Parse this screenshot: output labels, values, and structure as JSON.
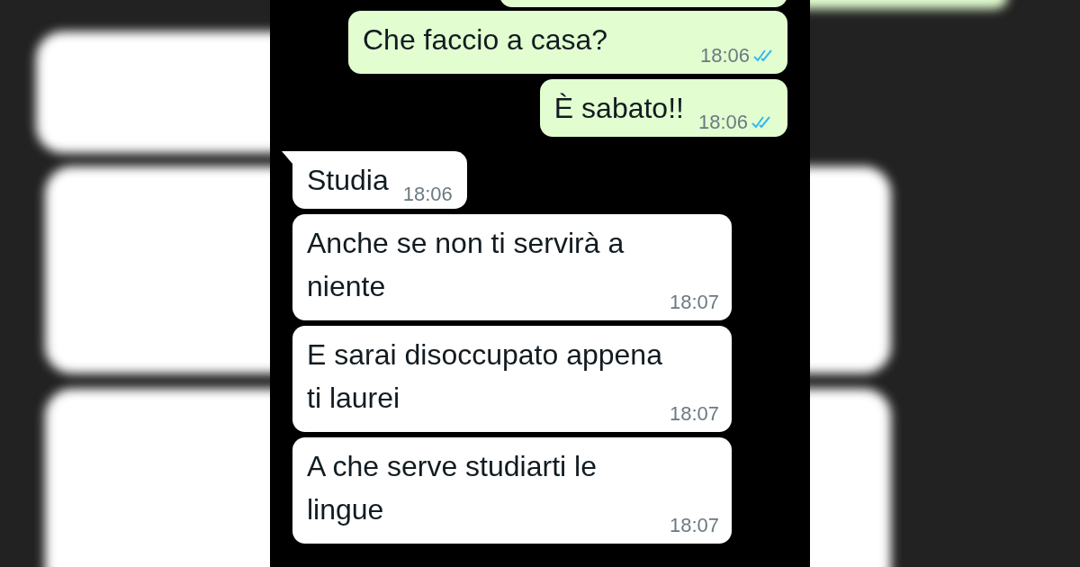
{
  "messages": [
    {
      "kind": "outgoing",
      "text": "Che faccio a casa?",
      "time": "18:06",
      "read": true,
      "tail": false
    },
    {
      "kind": "outgoing",
      "text": "È sabato!!",
      "time": "18:06",
      "read": true,
      "tail": false
    },
    {
      "kind": "incoming",
      "text": "Studia",
      "time": "18:06",
      "tail": true
    },
    {
      "kind": "incoming",
      "text": "Anche se non ti servirà a niente",
      "time": "18:07",
      "tail": false
    },
    {
      "kind": "incoming",
      "text": "E sarai disoccupato appena ti laurei",
      "time": "18:07",
      "tail": false
    },
    {
      "kind": "incoming",
      "text": "A che serve studiarti le lingue",
      "time": "18:07",
      "tail": false
    }
  ]
}
